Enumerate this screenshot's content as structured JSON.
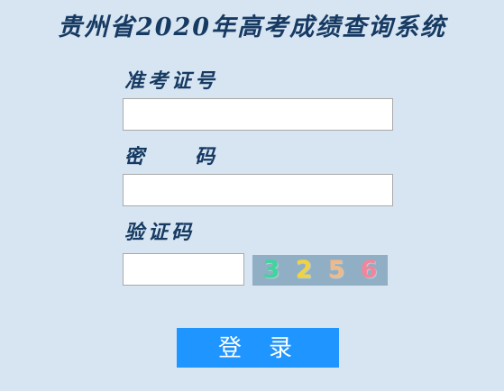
{
  "page": {
    "title": "贵州省2020年高考成绩查询系统"
  },
  "form": {
    "exam_number_label": "准考证号",
    "password_label_part1": "密",
    "password_label_part2": "码",
    "captcha_label": "验证码",
    "exam_number_value": "",
    "password_value": "",
    "captcha_value": ""
  },
  "captcha": {
    "digits": [
      "3",
      "2",
      "5",
      "6"
    ],
    "colors": [
      "#3fd59b",
      "#f1d240",
      "#f0b98a",
      "#f2859a"
    ]
  },
  "actions": {
    "login_label": "登录"
  }
}
